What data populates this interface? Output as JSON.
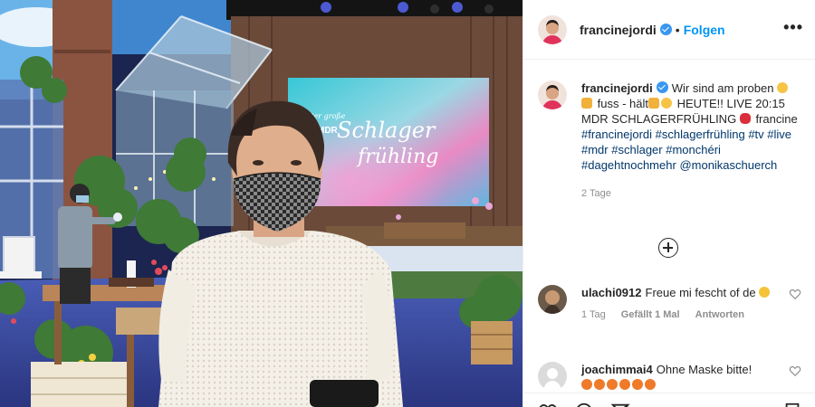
{
  "post": {
    "author": "francinejordi",
    "follow_label": "Folgen",
    "separator": "•",
    "more_label": "•••"
  },
  "caption": {
    "username": "francinejordi",
    "line_parts": {
      "p1": "Wir sind am proben",
      "p2": "fuss - hält",
      "p3": "HEUTE!! LIVE 20:15 MDR SCHLAGERFRÜHLING",
      "p4": "francine"
    },
    "hashtags": [
      "#francinejordi",
      "#schlagerfrühling",
      "#tv",
      "#live",
      "#mdr",
      "#schlager",
      "#monchéri",
      "#dagehtnochmehr"
    ],
    "mention": "@monikaschuerch",
    "age": "2 Tage"
  },
  "comments": [
    {
      "username": "ulachi0912",
      "text": "Freue mi fescht of de",
      "time": "1 Tag",
      "likes": "Gefällt 1 Mal",
      "reply": "Antworten"
    },
    {
      "username": "joachimmai4",
      "text": "Ohne Maske bitte!"
    }
  ],
  "photo": {
    "screen_text_1": "Der große",
    "screen_text_2": "MDR",
    "screen_text_3": "Schlager",
    "screen_text_4": "frühling"
  },
  "icons": [
    "verified-badge",
    "more-options-icon",
    "plus-circle-icon",
    "heart-icon",
    "comment-icon",
    "share-icon",
    "bookmark-icon"
  ],
  "colors": {
    "accent_blue": "#0095f6",
    "hashtag": "#00376b",
    "muted": "#8e8e8e"
  }
}
